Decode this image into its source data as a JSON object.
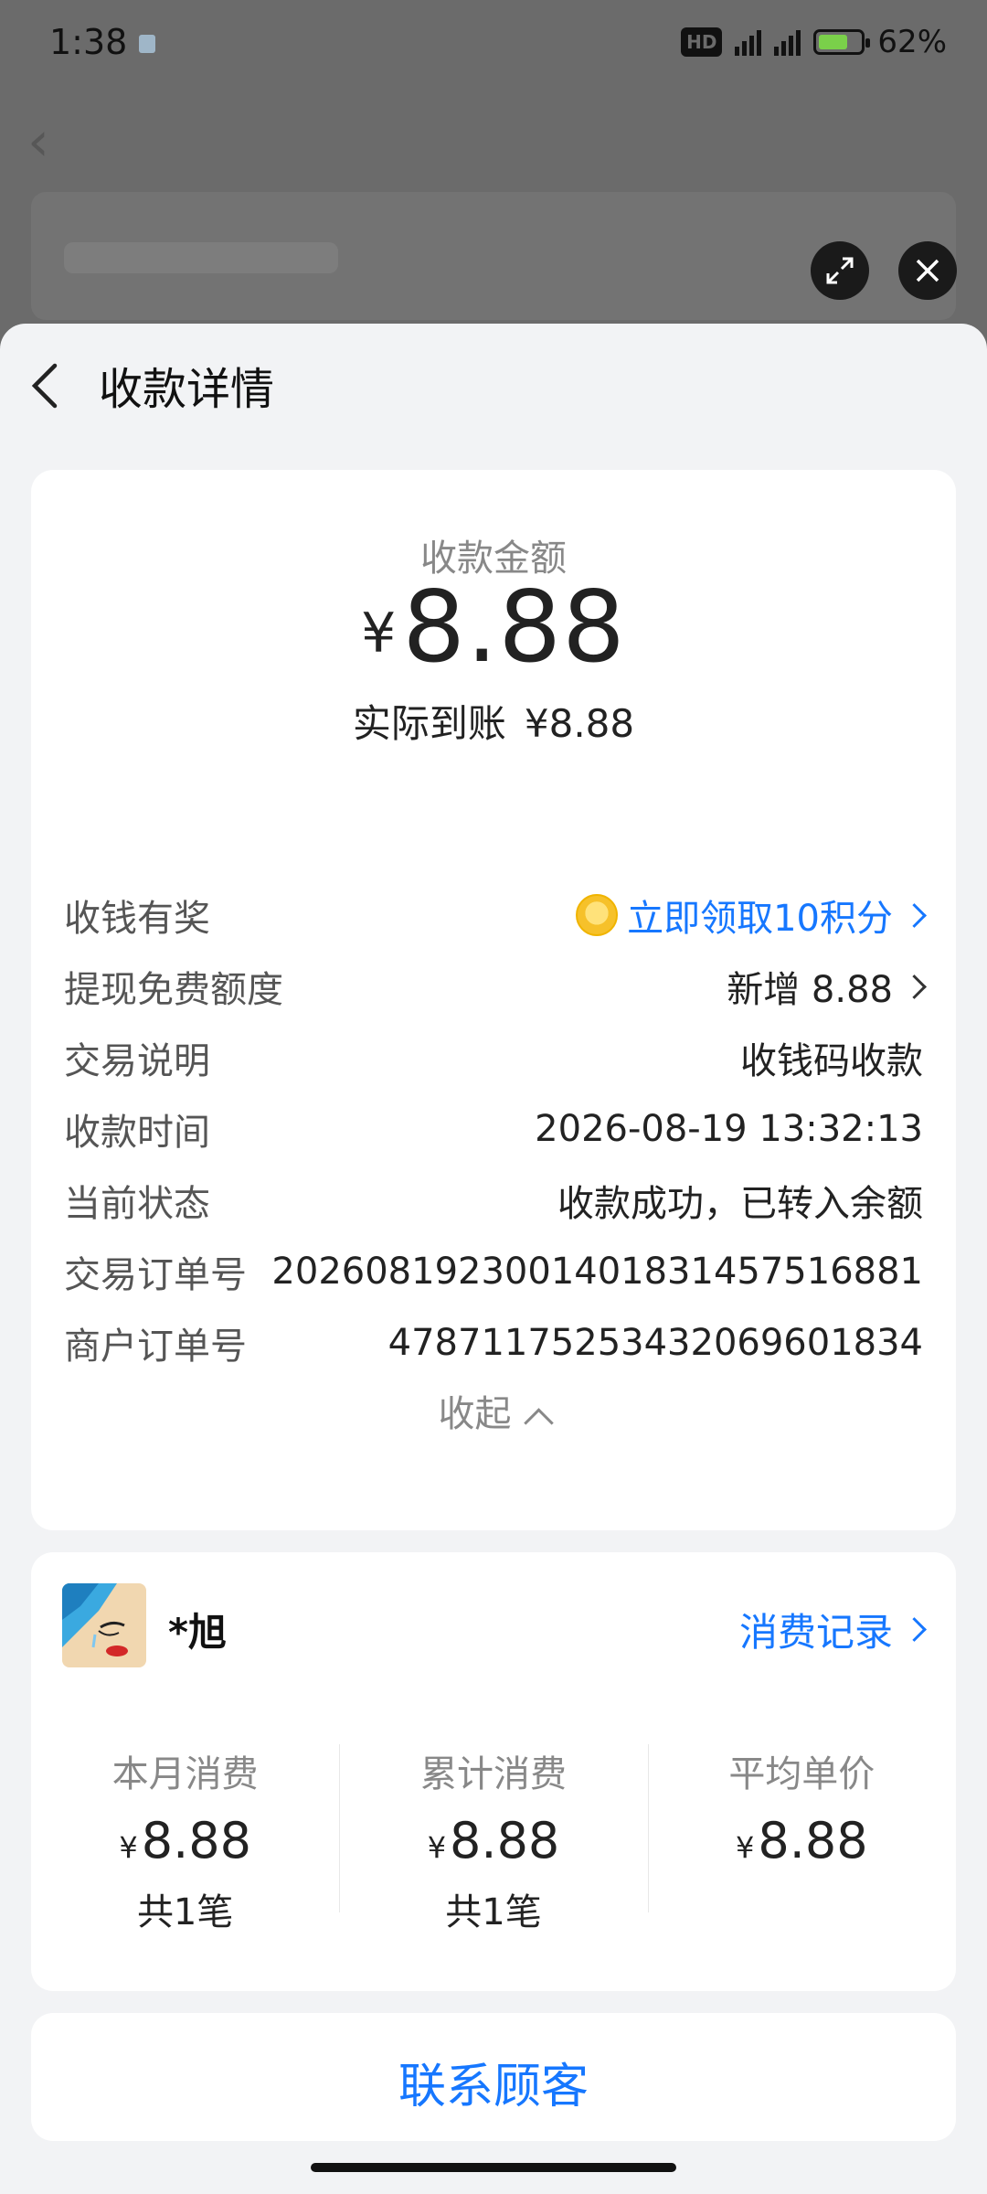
{
  "status_bar": {
    "time": "1:38",
    "hd": "HD",
    "net1": "5G",
    "net2": "4G",
    "battery_percent": "62",
    "battery_level": 0.62
  },
  "header": {
    "title": "收款详情"
  },
  "amount_card": {
    "amount_label": "收款金额",
    "currency": "¥",
    "amount": "8.88",
    "actual_label": "实际到账",
    "actual_value": "¥8.88",
    "rows": [
      {
        "label": "收钱有奖",
        "value": "立即领取10积分"
      },
      {
        "label": "提现免费额度",
        "value": "新增 8.88"
      },
      {
        "label": "交易说明",
        "value": "收钱码收款"
      },
      {
        "label": "收款时间",
        "value": "2026-08-19 13:32:13"
      },
      {
        "label": "当前状态",
        "value": "收款成功，已转入余额"
      },
      {
        "label": "交易订单号",
        "value": "2026081923001401831457516881"
      },
      {
        "label": "商户订单号",
        "value": "4787117525343206960183‍4"
      }
    ],
    "collapse_label": "收起"
  },
  "customer_card": {
    "name": "*旭",
    "records_link": "消费记录",
    "stats": [
      {
        "label": "本月消费",
        "currency": "¥",
        "value": "8.88",
        "count": "共1笔"
      },
      {
        "label": "累计消费",
        "currency": "¥",
        "value": "8.88",
        "count": "共1笔"
      },
      {
        "label": "平均单价",
        "currency": "¥",
        "value": "8.88",
        "count": ""
      }
    ]
  },
  "contact_button": {
    "label": "联系顾客"
  },
  "colors": {
    "accent": "#1677ff",
    "sheet_bg": "#f2f3f5",
    "card_bg": "#ffffff"
  }
}
